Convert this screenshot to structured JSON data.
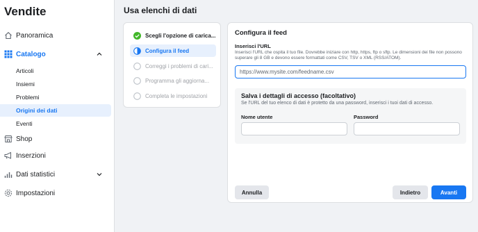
{
  "sidebar": {
    "app_title": "Vendite",
    "items": [
      {
        "label": "Panoramica"
      },
      {
        "label": "Catalogo"
      },
      {
        "label": "Shop"
      },
      {
        "label": "Inserzioni"
      },
      {
        "label": "Dati statistici"
      },
      {
        "label": "Impostazioni"
      }
    ],
    "catalog_subitems": [
      {
        "label": "Articoli"
      },
      {
        "label": "Insiemi"
      },
      {
        "label": "Problemi"
      },
      {
        "label": "Origini dei dati"
      },
      {
        "label": "Eventi"
      }
    ]
  },
  "page": {
    "title": "Usa elenchi di dati"
  },
  "steps": [
    {
      "label": "Scegli l'opzione di carica...",
      "state": "done"
    },
    {
      "label": "Configura il feed",
      "state": "current"
    },
    {
      "label": "Correggi i problemi di cari...",
      "state": "pending"
    },
    {
      "label": "Programma gli aggiorna...",
      "state": "pending"
    },
    {
      "label": "Completa le impostazioni",
      "state": "pending"
    }
  ],
  "feed": {
    "section_title": "Configura il feed",
    "url_label": "Inserisci l'URL",
    "url_help": "Inserisci l'URL che ospita il tuo file. Dovrebbe iniziare con http, https, ftp o sftp. Le dimensioni dei file non possono superare gli 8 GB e devono essere formattati come CSV, TSV o XML (RSS/ATOM).",
    "url_placeholder": "https://www.mysite.com/feedname.csv",
    "url_value": ""
  },
  "access": {
    "title": "Salva i dettagli di accesso (facoltativo)",
    "description": "Se l'URL del tuo elenco di dati è protetto da una password, inserisci i tuoi dati di accesso.",
    "username_label": "Nome utente",
    "username_value": "",
    "password_label": "Password",
    "password_value": ""
  },
  "footer": {
    "cancel_label": "Annulla",
    "back_label": "Indietro",
    "next_label": "Avanti"
  },
  "colors": {
    "accent": "#1877f2",
    "success": "#42b72a",
    "text": "#1c1e21",
    "muted": "#606770",
    "background": "#f0f2f5"
  }
}
